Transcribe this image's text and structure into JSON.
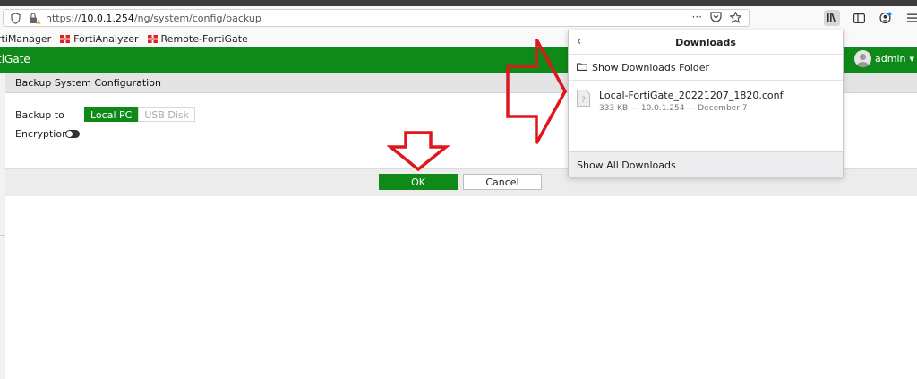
{
  "browser": {
    "url_prefix": "https://",
    "url_host": "10.0.1.254",
    "url_path": "/ng/system/config/backup",
    "url_menu": "···"
  },
  "bookmarks": [
    {
      "label": "rtiManager"
    },
    {
      "label": "FortiAnalyzer"
    },
    {
      "label": "Remote-FortiGate"
    }
  ],
  "header": {
    "brand": "tiGate",
    "user": "admin"
  },
  "page": {
    "section_title": "Backup System Configuration",
    "backup_to_label": "Backup to",
    "backup_options": [
      "Local PC",
      "USB Disk"
    ],
    "encryption_label": "Encryption",
    "ok_label": "OK",
    "cancel_label": "Cancel"
  },
  "downloads": {
    "title": "Downloads",
    "show_folder": "Show Downloads Folder",
    "file_name": "Local-FortiGate_20221207_1820.conf",
    "file_meta": "333 KB — 10.0.1.254 — December 7",
    "show_all": "Show All Downloads"
  },
  "colors": {
    "fortigate_green": "#0f8a19",
    "annotation_red": "#e0161d"
  }
}
